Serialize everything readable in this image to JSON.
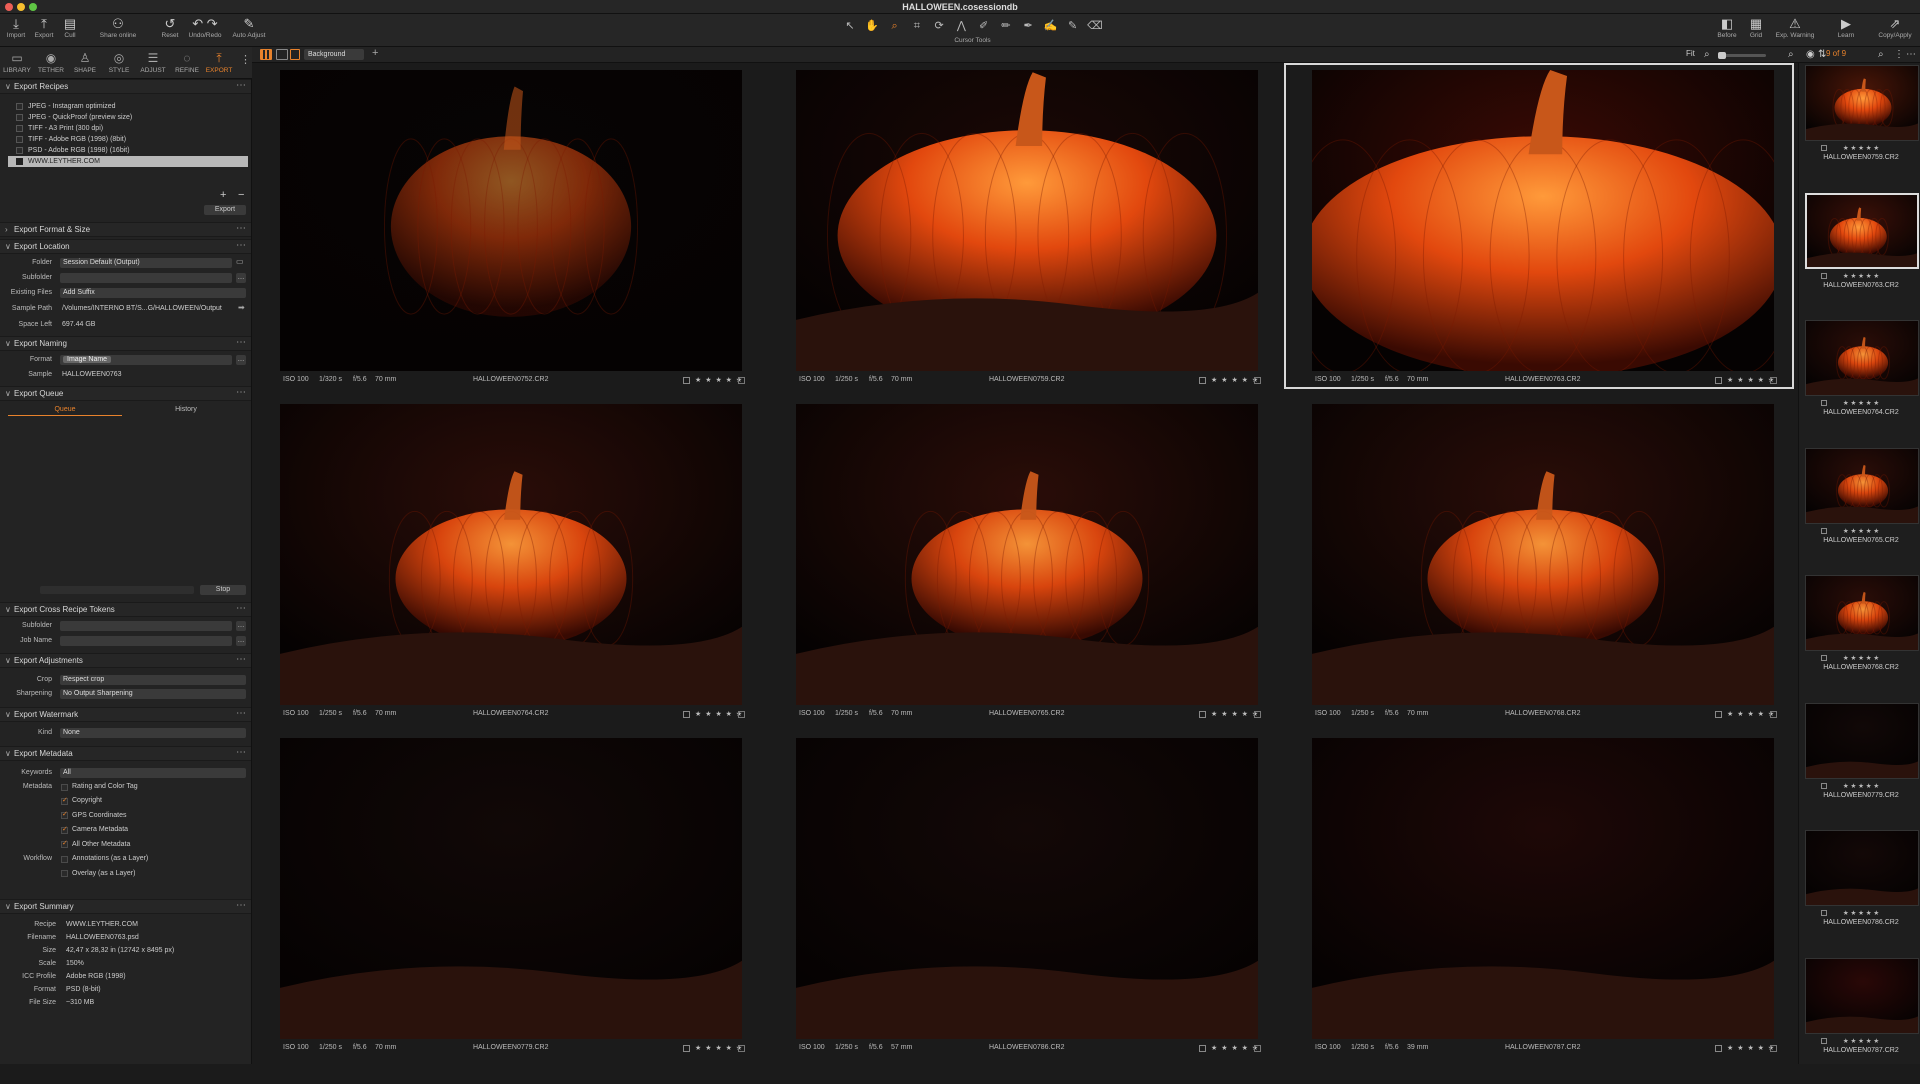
{
  "window": {
    "title": "HALLOWEEN.cosessiondb"
  },
  "toolbar": {
    "left": [
      {
        "icon": "import-icon",
        "label": "Import"
      },
      {
        "icon": "export-icon",
        "label": "Export"
      },
      {
        "icon": "cull-icon",
        "label": "Cull"
      },
      {
        "icon": "share-icon",
        "label": "Share online"
      },
      {
        "icon": "reset-icon",
        "label": "Reset"
      },
      {
        "icon": "undo-redo-icon",
        "label": "Undo/Redo"
      },
      {
        "icon": "auto-adjust-icon",
        "label": "Auto Adjust"
      }
    ],
    "cursor_tools_label": "Cursor Tools",
    "right": [
      {
        "icon": "before-icon",
        "label": "Before"
      },
      {
        "icon": "grid-icon",
        "label": "Grid"
      },
      {
        "icon": "warning-icon",
        "label": "Exp. Warning"
      },
      {
        "icon": "learn-icon",
        "label": "Learn"
      },
      {
        "icon": "copy-apply-icon",
        "label": "Copy/Apply"
      }
    ]
  },
  "tooltabs": [
    {
      "label": "LIBRARY",
      "active": false
    },
    {
      "label": "TETHER",
      "active": false
    },
    {
      "label": "SHAPE",
      "active": false
    },
    {
      "label": "STYLE",
      "active": false
    },
    {
      "label": "ADJUST",
      "active": false
    },
    {
      "label": "REFINE",
      "active": false
    },
    {
      "label": "EXPORT",
      "active": true
    }
  ],
  "viewer": {
    "background_select": "Background",
    "fit_label": "Fit",
    "count": "9 of 9"
  },
  "export_recipes": {
    "title": "Export Recipes",
    "items": [
      {
        "label": "JPEG - Instagram optimized",
        "checked": false
      },
      {
        "label": "JPEG - QuickProof (preview size)",
        "checked": false
      },
      {
        "label": "TIFF - A3 Print (300 dpi)",
        "checked": false
      },
      {
        "label": "TIFF - Adobe RGB (1998) (8bit)",
        "checked": false
      },
      {
        "label": "PSD - Adobe RGB (1998) (16bit)",
        "checked": false
      },
      {
        "label": "WWW.LEYTHER.COM",
        "checked": true
      }
    ],
    "export_button": "Export"
  },
  "export_format": {
    "title": "Export Format & Size"
  },
  "export_location": {
    "title": "Export Location",
    "folder_label": "Folder",
    "folder_value": "Session Default (Output)",
    "subfolder_label": "Subfolder",
    "existing_label": "Existing Files",
    "existing_value": "Add Suffix",
    "sample_path_label": "Sample Path",
    "sample_path_value": "/Volumes/INTERNO BT/S...G/HALLOWEEN/Output",
    "space_left_label": "Space Left",
    "space_left_value": "697.44 GB"
  },
  "export_naming": {
    "title": "Export Naming",
    "format_label": "Format",
    "format_token": "Image Name",
    "sample_label": "Sample",
    "sample_value": "HALLOWEEN0763"
  },
  "export_queue": {
    "title": "Export Queue",
    "tab_queue": "Queue",
    "tab_history": "History",
    "stop_button": "Stop"
  },
  "cross_recipe": {
    "title": "Export Cross Recipe Tokens",
    "subfolder_label": "Subfolder",
    "job_name_label": "Job Name"
  },
  "export_adjustments": {
    "title": "Export Adjustments",
    "crop_label": "Crop",
    "crop_value": "Respect crop",
    "sharpening_label": "Sharpening",
    "sharpening_value": "No Output Sharpening"
  },
  "export_watermark": {
    "title": "Export Watermark",
    "kind_label": "Kind",
    "kind_value": "None"
  },
  "export_metadata": {
    "title": "Export Metadata",
    "keywords_label": "Keywords",
    "keywords_value": "All",
    "metadata_label": "Metadata",
    "workflow_label": "Workflow",
    "options": [
      {
        "label": "Rating and Color Tag",
        "checked": false
      },
      {
        "label": "Copyright",
        "checked": true
      },
      {
        "label": "GPS Coordinates",
        "checked": true
      },
      {
        "label": "Camera Metadata",
        "checked": true
      },
      {
        "label": "All Other Metadata",
        "checked": true
      },
      {
        "label": "Annotations (as a Layer)",
        "checked": false
      },
      {
        "label": "Overlay (as a Layer)",
        "checked": false
      }
    ]
  },
  "export_summary": {
    "title": "Export Summary",
    "rows": [
      {
        "label": "Recipe",
        "value": "WWW.LEYTHER.COM"
      },
      {
        "label": "Filename",
        "value": "HALLOWEEN0763.psd"
      },
      {
        "label": "Size",
        "value": "42,47 x 28,32 in (12742 x 8495 px)"
      },
      {
        "label": "Scale",
        "value": "150%"
      },
      {
        "label": "ICC Profile",
        "value": "Adobe RGB (1998)"
      },
      {
        "label": "Format",
        "value": "PSD (8-bit)"
      },
      {
        "label": "File Size",
        "value": "~310 MB"
      }
    ]
  },
  "images": [
    {
      "iso": "ISO 100",
      "shutter": "1/320 s",
      "aperture": "f/5.6",
      "focal": "70 mm",
      "filename": "HALLOWEEN0752.CR2",
      "stars": "★ ★ ★ ★ ★",
      "selected": false
    },
    {
      "iso": "ISO 100",
      "shutter": "1/250 s",
      "aperture": "f/5.6",
      "focal": "70 mm",
      "filename": "HALLOWEEN0759.CR2",
      "stars": "★ ★ ★ ★ ★",
      "selected": false
    },
    {
      "iso": "ISO 100",
      "shutter": "1/250 s",
      "aperture": "f/5.6",
      "focal": "70 mm",
      "filename": "HALLOWEEN0763.CR2",
      "stars": "★ ★ ★ ★ ★",
      "selected": true
    },
    {
      "iso": "ISO 100",
      "shutter": "1/250 s",
      "aperture": "f/5.6",
      "focal": "70 mm",
      "filename": "HALLOWEEN0764.CR2",
      "stars": "★ ★ ★ ★ ★",
      "selected": false
    },
    {
      "iso": "ISO 100",
      "shutter": "1/250 s",
      "aperture": "f/5.6",
      "focal": "70 mm",
      "filename": "HALLOWEEN0765.CR2",
      "stars": "★ ★ ★ ★ ★",
      "selected": false
    },
    {
      "iso": "ISO 100",
      "shutter": "1/250 s",
      "aperture": "f/5.6",
      "focal": "70 mm",
      "filename": "HALLOWEEN0768.CR2",
      "stars": "★ ★ ★ ★ ★",
      "selected": false
    },
    {
      "iso": "ISO 100",
      "shutter": "1/250 s",
      "aperture": "f/5.6",
      "focal": "70 mm",
      "filename": "HALLOWEEN0779.CR2",
      "stars": "★ ★ ★ ★ ★",
      "selected": false
    },
    {
      "iso": "ISO 100",
      "shutter": "1/250 s",
      "aperture": "f/5.6",
      "focal": "57 mm",
      "filename": "HALLOWEEN0786.CR2",
      "stars": "★ ★ ★ ★ ★",
      "selected": false
    },
    {
      "iso": "ISO 100",
      "shutter": "1/250 s",
      "aperture": "f/5.6",
      "focal": "39 mm",
      "filename": "HALLOWEEN0787.CR2",
      "stars": "★ ★ ★ ★ ★",
      "selected": false
    }
  ],
  "filmstrip": [
    {
      "filename": "HALLOWEEN0759.CR2",
      "stars": "★ ★ ★ ★ ★"
    },
    {
      "filename": "HALLOWEEN0763.CR2",
      "stars": "★ ★ ★ ★ ★"
    },
    {
      "filename": "HALLOWEEN0764.CR2",
      "stars": "★ ★ ★ ★ ★"
    },
    {
      "filename": "HALLOWEEN0765.CR2",
      "stars": "★ ★ ★ ★ ★"
    },
    {
      "filename": "HALLOWEEN0768.CR2",
      "stars": "★ ★ ★ ★ ★"
    },
    {
      "filename": "HALLOWEEN0779.CR2",
      "stars": "★ ★ ★ ★ ★"
    },
    {
      "filename": "HALLOWEEN0786.CR2",
      "stars": "★ ★ ★ ★ ★"
    },
    {
      "filename": "HALLOWEEN0787.CR2",
      "stars": "★ ★ ★ ★ ★"
    }
  ],
  "colors": {
    "accent": "#e8822c",
    "pumpkin": "#e2480e"
  }
}
